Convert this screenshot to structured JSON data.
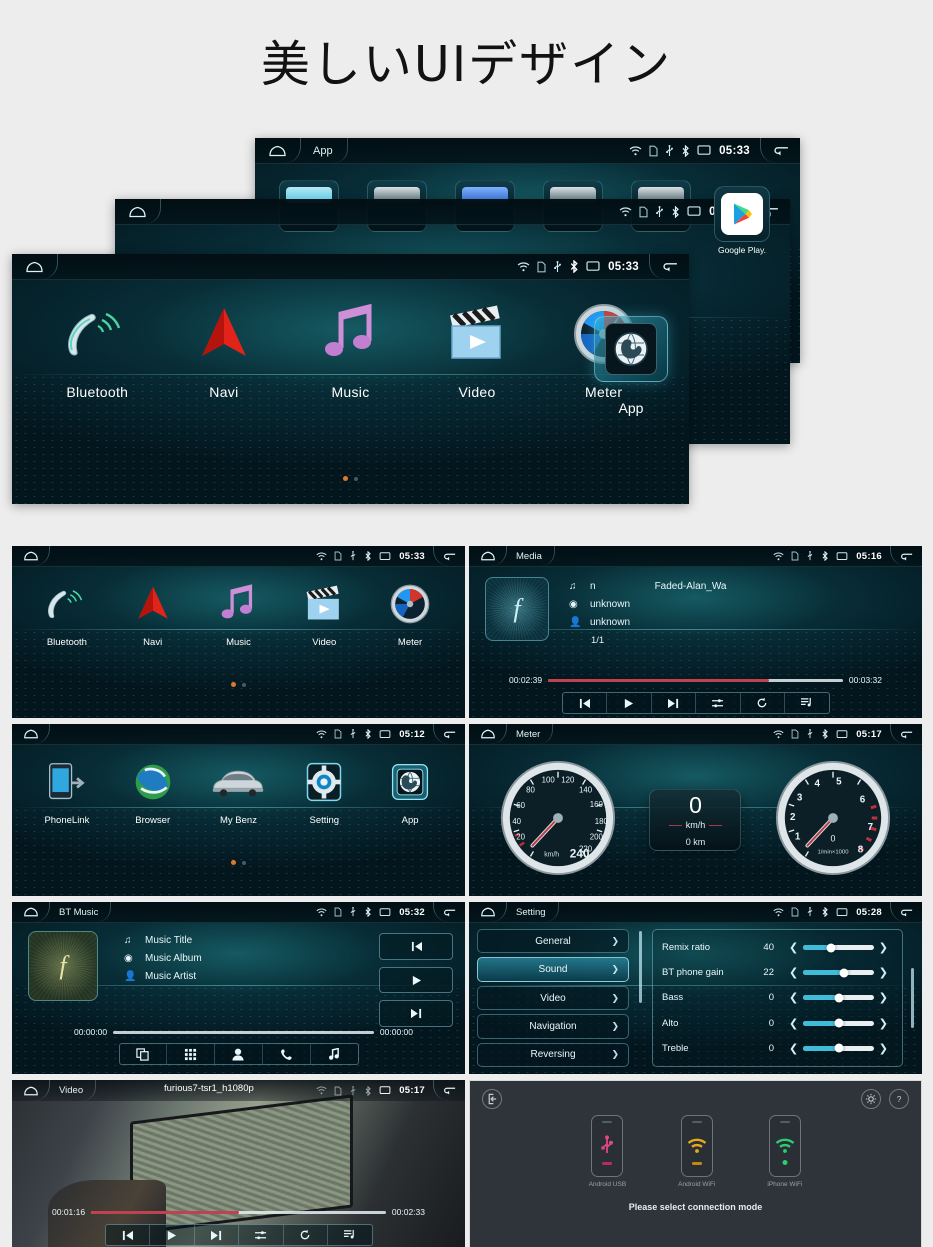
{
  "page": {
    "title": "美しいUIデザイン",
    "background_color": "#ededed"
  },
  "colors": {
    "accent_cyan": "#41bcd8",
    "progress_red": "#c0414f",
    "dot_orange": "#e0772c",
    "screen_dark": "#04242c"
  },
  "hero": {
    "app_screen": {
      "home_icon": "home-icon",
      "title": "App",
      "status_icons": [
        "wifi-icon",
        "sdcard-icon",
        "usb-icon",
        "bluetooth-icon",
        "display-icon"
      ],
      "time": "05:33",
      "back_icon": "back-arrow-icon",
      "tiles": [
        {
          "label": "",
          "icon": "app-tile-icon"
        },
        {
          "label": "",
          "icon": "app-tile-icon"
        },
        {
          "label": "",
          "icon": "app-tile-icon"
        },
        {
          "label": "",
          "icon": "app-tile-icon"
        },
        {
          "label": "",
          "icon": "app-tile-icon"
        }
      ],
      "google_play": {
        "label": "Google Play.",
        "icon": "google-play-icon"
      }
    },
    "mid_screen": {
      "home_icon": "home-icon",
      "status_icons": [
        "wifi-icon",
        "sdcard-icon",
        "usb-icon",
        "bluetooth-icon",
        "display-icon"
      ],
      "time": "05:12",
      "back_icon": "back-arrow-icon"
    },
    "front_screen": {
      "home_icon": "home-icon",
      "status_icons": [
        "wifi-icon",
        "sdcard-icon",
        "usb-icon",
        "bluetooth-icon",
        "display-icon"
      ],
      "time": "05:33",
      "back_icon": "back-arrow-icon",
      "items": [
        {
          "label": "Bluetooth",
          "icon": "bluetooth-handset-icon"
        },
        {
          "label": "Navi",
          "icon": "navigation-arrow-icon"
        },
        {
          "label": "Music",
          "icon": "music-note-icon"
        },
        {
          "label": "Video",
          "icon": "clapperboard-play-icon"
        },
        {
          "label": "Meter",
          "icon": "gauge-icon"
        }
      ],
      "app_float": {
        "label": "App",
        "icon": "globe-icon"
      }
    }
  },
  "grid": {
    "home1": {
      "home_icon": "home-icon",
      "title": "",
      "time": "05:33",
      "status_icons": [
        "wifi-icon",
        "sdcard-icon",
        "usb-icon",
        "bluetooth-icon",
        "display-icon"
      ],
      "back_icon": "back-arrow-icon",
      "items": [
        {
          "label": "Bluetooth",
          "icon": "bluetooth-handset-icon"
        },
        {
          "label": "Navi",
          "icon": "navigation-arrow-icon"
        },
        {
          "label": "Music",
          "icon": "music-note-icon"
        },
        {
          "label": "Video",
          "icon": "clapperboard-play-icon"
        },
        {
          "label": "Meter",
          "icon": "gauge-icon"
        }
      ]
    },
    "media": {
      "home_icon": "home-icon",
      "title": "Media",
      "time": "05:16",
      "back_icon": "back-arrow-icon",
      "album_art_glyph": "f",
      "track_label_icon": "music-note-icon",
      "track_prefix": "n",
      "track_name": "Faded-Alan_Wa",
      "album_icon": "disc-icon",
      "album": "unknown",
      "artist_icon": "person-icon",
      "artist": "unknown",
      "index": "1/1",
      "elapsed": "00:02:39",
      "duration": "00:03:32",
      "progress_percent": 75,
      "controls": [
        "prev-track-icon",
        "play-icon",
        "next-track-icon",
        "shuffle-icon",
        "repeat-icon",
        "playlist-icon"
      ]
    },
    "home2": {
      "home_icon": "home-icon",
      "title": "",
      "time": "05:12",
      "back_icon": "back-arrow-icon",
      "items": [
        {
          "label": "PhoneLink",
          "icon": "phone-link-icon"
        },
        {
          "label": "Browser",
          "icon": "globe-browser-icon"
        },
        {
          "label": "My Benz",
          "icon": "car-icon"
        },
        {
          "label": "Setting",
          "icon": "gear-icon"
        },
        {
          "label": "App",
          "icon": "globe-icon"
        }
      ]
    },
    "meter": {
      "home_icon": "home-icon",
      "title": "Meter",
      "time": "05:17",
      "back_icon": "back-arrow-icon",
      "speedometer": {
        "unit": "km/h",
        "max_label": "240",
        "ticks": [
          "20",
          "40",
          "60",
          "80",
          "100",
          "120",
          "140",
          "160",
          "180",
          "200",
          "220",
          "240"
        ]
      },
      "center": {
        "value": "0",
        "unit": "km/h",
        "odometer": "0 km"
      },
      "tachometer": {
        "unit": "1/min×1000",
        "value": "0",
        "ticks": [
          "1",
          "2",
          "3",
          "4",
          "5",
          "6",
          "7",
          "8"
        ]
      }
    },
    "btmusic": {
      "home_icon": "home-icon",
      "title": "BT Music",
      "time": "05:32",
      "back_icon": "back-arrow-icon",
      "album_art_glyph": "f",
      "rows": [
        {
          "icon": "music-note-icon",
          "label": "Music Title"
        },
        {
          "icon": "disc-icon",
          "label": "Music Album"
        },
        {
          "icon": "person-icon",
          "label": "Music Artist"
        }
      ],
      "side_buttons": [
        "prev-track-icon",
        "play-icon",
        "next-track-icon"
      ],
      "elapsed": "00:00:00",
      "duration": "00:00:00",
      "progress_percent": 0,
      "toolbar": [
        "devices-icon",
        "dialpad-icon",
        "contacts-icon",
        "call-history-icon",
        "music-icon"
      ]
    },
    "setting": {
      "home_icon": "home-icon",
      "title": "Setting",
      "time": "05:28",
      "back_icon": "back-arrow-icon",
      "nav": [
        {
          "label": "General",
          "active": false
        },
        {
          "label": "Sound",
          "active": true
        },
        {
          "label": "Video",
          "active": false
        },
        {
          "label": "Navigation",
          "active": false
        },
        {
          "label": "Reversing",
          "active": false
        }
      ],
      "rows": [
        {
          "name": "Remix ratio",
          "value": "40",
          "percent": 40
        },
        {
          "name": "BT phone gain",
          "value": "22",
          "percent": 58
        },
        {
          "name": "Bass",
          "value": "0",
          "percent": 50
        },
        {
          "name": "Alto",
          "value": "0",
          "percent": 50
        },
        {
          "name": "Treble",
          "value": "0",
          "percent": 50
        }
      ]
    },
    "video": {
      "home_icon": "home-icon",
      "title": "Video",
      "file_name": "furious7-tsr1_h1080p",
      "time": "05:17",
      "back_icon": "back-arrow-icon",
      "elapsed": "00:01:16",
      "duration": "00:02:33",
      "progress_percent": 50,
      "controls": [
        "prev-track-icon",
        "play-icon",
        "next-track-icon",
        "shuffle-icon",
        "repeat-icon",
        "playlist-icon"
      ]
    },
    "connection": {
      "back_icon": "exit-icon",
      "settings_icon": "gear-icon",
      "help_icon": "help-icon",
      "options": [
        {
          "label": "Android USB",
          "icon": "usb-icon",
          "color": "#e0487f"
        },
        {
          "label": "Android WiFi",
          "icon": "wifi-icon",
          "color": "#e8a81e"
        },
        {
          "label": "iPhone WiFi",
          "icon": "wifi-icon",
          "color": "#2ecc71"
        }
      ],
      "message": "Please select connection mode"
    }
  }
}
